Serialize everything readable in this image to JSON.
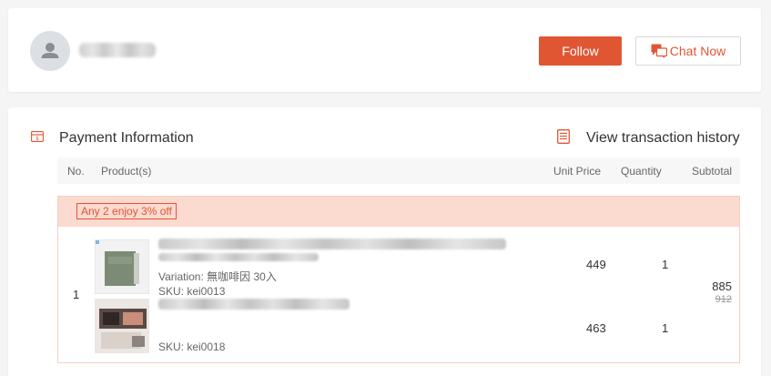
{
  "seller": {
    "follow_label": "Follow",
    "chat_label": "Chat Now"
  },
  "payment": {
    "title": "Payment Information",
    "history_label": "View transaction history"
  },
  "table": {
    "headers": {
      "no": "No.",
      "products": "Product(s)",
      "unit_price": "Unit Price",
      "quantity": "Quantity",
      "subtotal": "Subtotal"
    }
  },
  "order": {
    "promo_label": "Any 2 enjoy 3% off",
    "row_number": "1",
    "items": [
      {
        "variation": "Variation: 無咖啡因 30入",
        "sku": "SKU: kei0013",
        "unit_price": "449",
        "quantity": "1"
      },
      {
        "sku": "SKU: kei0018",
        "unit_price": "463",
        "quantity": "1"
      }
    ],
    "subtotal": "885",
    "original_subtotal": "912"
  },
  "colors": {
    "accent": "#e05633",
    "promo_band": "#fbdad0",
    "header_bg": "#f7f7f7"
  },
  "icons": {
    "avatar": "user-avatar-icon",
    "chat": "chat-bubble-icon",
    "payment": "payment-card-icon",
    "history": "document-list-icon"
  }
}
